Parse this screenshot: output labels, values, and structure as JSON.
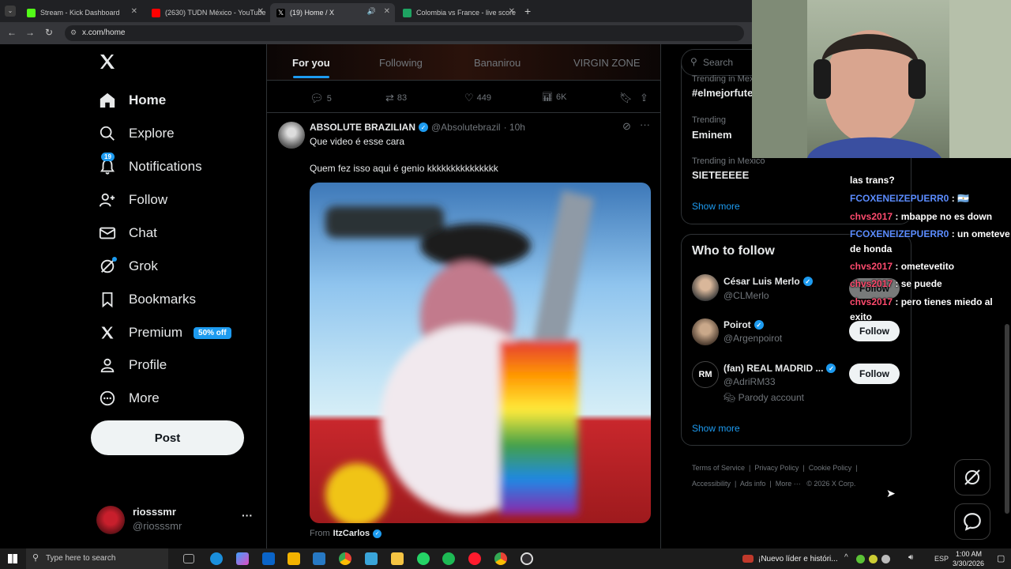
{
  "browser": {
    "tabs": [
      {
        "title": "Stream - Kick Dashboard",
        "color": "#53fc18"
      },
      {
        "title": "(2630) TUDN México - YouTube",
        "color": "#ff0000"
      },
      {
        "title": "(19) Home / X",
        "color": "#ffffff"
      },
      {
        "title": "Colombia vs France - live score",
        "color": "#1ea362"
      }
    ],
    "url": "x.com/home"
  },
  "sidebar": {
    "items": [
      {
        "label": "Home",
        "icon": "home-icon"
      },
      {
        "label": "Explore",
        "icon": "search-icon"
      },
      {
        "label": "Notifications",
        "icon": "bell-icon",
        "badge": "19"
      },
      {
        "label": "Follow",
        "icon": "person-plus-icon"
      },
      {
        "label": "Chat",
        "icon": "mail-icon"
      },
      {
        "label": "Grok",
        "icon": "grok-icon"
      },
      {
        "label": "Bookmarks",
        "icon": "bookmark-icon"
      },
      {
        "label": "Premium",
        "icon": "x-logo-icon",
        "badge": "50% off"
      },
      {
        "label": "Profile",
        "icon": "person-icon"
      },
      {
        "label": "More",
        "icon": "more-circle-icon"
      }
    ],
    "post_label": "Post",
    "account": {
      "name": "riosssmr",
      "handle": "@riosssmr"
    }
  },
  "feed": {
    "tabs": [
      "For you",
      "Following",
      "Bananirou",
      "VIRGIN ZONE"
    ],
    "prev_actions": {
      "replies": "5",
      "reposts": "83",
      "likes": "449",
      "views": "6K"
    },
    "tweet": {
      "author": "ABSOLUTE BRAZILIAN",
      "handle": "@Absolutebrazil",
      "time": "· 10h",
      "text1": "Que video é esse cara",
      "text2": "Quem fez isso aqui é genio kkkkkkkkkkkkkkk",
      "from_label": "From",
      "from_user": "ItzCarlos"
    }
  },
  "right": {
    "search_placeholder": "Search",
    "trends": [
      {
        "meta": "Trending in Mexico",
        "name": "#elmejorfute"
      },
      {
        "meta": "Trending",
        "name": "Eminem"
      },
      {
        "meta": "Trending in Mexico",
        "name": "SIETEEEEE"
      }
    ],
    "show_more": "Show more",
    "who_title": "Who to follow",
    "who": [
      {
        "name": "César Luis Merlo",
        "handle": "@CLMerlo",
        "button": "Follow"
      },
      {
        "name": "Poirot",
        "handle": "@Argenpoirot",
        "button": "Follow"
      },
      {
        "name": "(fan) REAL MADRID ...",
        "handle": "@AdriRM33",
        "extra": "Parody account",
        "button": "Follow"
      }
    ],
    "show_more2": "Show more",
    "footer": [
      "Terms of Service",
      "Privacy Policy",
      "Cookie Policy",
      "Accessibility",
      "Ads info",
      "More ···",
      "© 2026 X Corp."
    ]
  },
  "stream_chat": [
    {
      "user": "",
      "msg": "las trans?"
    },
    {
      "user": "FCOXENEIZEPUERR0",
      "msg": " : 🇦🇷",
      "color": "#5b8cff"
    },
    {
      "user": "chvs2017",
      "msg": " : mbappe no es down",
      "color": "#ff4b6e"
    },
    {
      "user": "FCOXENEIZEPUERR0",
      "msg": " : un ometeve",
      "color": "#5b8cff"
    },
    {
      "user": "",
      "msg": "de honda"
    },
    {
      "user": "chvs2017",
      "msg": " : ometevetito",
      "color": "#ff4b6e"
    },
    {
      "user": "chvs2017",
      "msg": " : se puede",
      "color": "#ff4b6e"
    },
    {
      "user": "chvs2017",
      "msg": " : pero tienes miedo al",
      "color": "#ff4b6e"
    },
    {
      "user": "",
      "msg": "exito"
    }
  ],
  "taskbar": {
    "search_placeholder": "Type here to search",
    "news": "¡Nuevo líder e históri...",
    "lang": "ESP",
    "time": "1:00 AM",
    "date": "3/30/2026"
  }
}
